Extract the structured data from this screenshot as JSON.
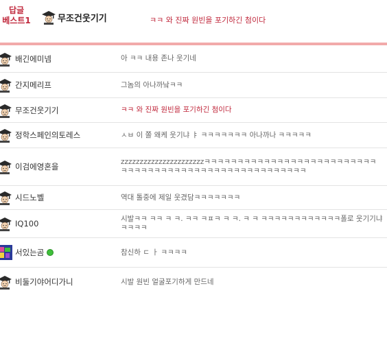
{
  "best": {
    "label_line1": "답글",
    "label_line2": "베스트1",
    "nickname": "무조건웃기기",
    "content": "ㅋㅋ 와 진짜 원빈을 포기하긴 첨이다"
  },
  "comments": [
    {
      "nickname": "배긴에미넴",
      "content": "아 ㅋㅋ 내용 존나 웃기네",
      "avatar": "hat-avatar-icon"
    },
    {
      "nickname": "간지메리프",
      "content": "그놈의 아나까낰ㅋㅋ",
      "avatar": "hat-avatar-icon"
    },
    {
      "nickname": "무조건웃기기",
      "content": "ㅋㅋ 와 진짜 원빈을 포기하긴 첨이다",
      "avatar": "hat-avatar-icon"
    },
    {
      "nickname": "정학스페인의토레스",
      "content": "ㅅㅂ 이 쫄 왜케 웃기냐 ㅑ ㅋㅋㅋㅋㅋㅋㅋ 아나까나 ㅋㅋㅋㅋㅋ",
      "avatar": "hat-avatar-icon"
    },
    {
      "nickname": "이검에영혼을",
      "content": "zzzzzzzzzzzzzzzzzzzzzzㅋㅋㅋㅋㅋㅋㅋㅋㅋㅋㅋㅋㅋㅋㅋㅋㅋㅋㅋㅋㅋㅋㅋㅋㅋㅋㅋㅋㅋㅋㅋㅋㅋㅋㅋㅋㅋㅋㅋㅋㅋㅋㅋㅋㅋㅋㅋㅋㅋㅋㅋㅋㅋㅋ",
      "avatar": "hat-avatar-icon"
    },
    {
      "nickname": "시드노벨",
      "content": "역대 톨중에 제일 웃겼담ㅋㅋㅋㅋㅋㅋㅋ",
      "avatar": "hat-avatar-icon"
    },
    {
      "nickname": "IQ100",
      "content": "시발ㅋㅋ ㅋㅋ ㅋ ㅋ. ㅋㅋ ㅋㅍㅋ ㅋ ㅋ. ㅋ ㅋ ㅋㅋㅋㅋㅋㅋㅋㅋㅋㅋㅋㅋ폴로 웃기기냐ㅋㅋㅋㅋ",
      "avatar": "hat-avatar-icon"
    },
    {
      "nickname": "서있는곰",
      "content": "참신하 ㄷ ㅏ ㅋㅋㅋㅋ",
      "avatar": "pixel-avatar-icon",
      "badge": "online-bubble-icon"
    },
    {
      "nickname": "비둘기야어디가니",
      "content": "시발 원빈 얼굴포기하게 만드네",
      "avatar": "hat-avatar-icon"
    }
  ],
  "colors": {
    "accent": "#c0283c",
    "rule": "#f2aaaa"
  }
}
